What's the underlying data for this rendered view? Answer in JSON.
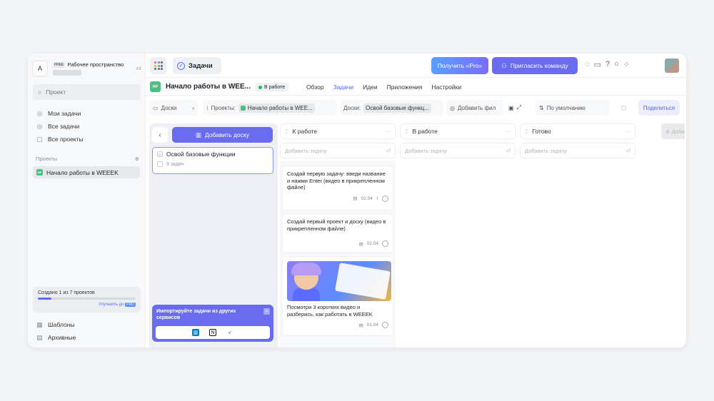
{
  "sidebar": {
    "workspace_avatar": "A",
    "workspace_plan": "FREE",
    "workspace_title": "Рабочее пространство",
    "collapse_icon": "‹‹",
    "search_placeholder": "Проект",
    "nav": [
      {
        "label": "Мои задачи",
        "icon": "check-circle-icon"
      },
      {
        "label": "Все задачи",
        "icon": "tasks-icon"
      },
      {
        "label": "Все проекты",
        "icon": "grid-icon"
      }
    ],
    "projects_section": "Проекты",
    "project_badge": "НР",
    "project_item": "Начало работы в WEEEK",
    "quota_text": "Создано 1 из 7 проектов",
    "quota_progress": 0.14,
    "upgrade_text": "Улучшить до",
    "upgrade_badge": "PRO",
    "bottom": [
      {
        "label": "Шаблоны",
        "icon": "templates-icon"
      },
      {
        "label": "Архивные",
        "icon": "archive-icon"
      }
    ]
  },
  "topbar": {
    "section_title": "Задачи",
    "pro_button": "Получить «Pro»",
    "invite_button": "Пригласить команду"
  },
  "project": {
    "badge": "НР",
    "title": "Начало работы в WEE...",
    "status": "В работе",
    "tabs": [
      "Обзор",
      "Задачи",
      "Идеи",
      "Приложения",
      "Настройки"
    ],
    "active_tab": "Задачи"
  },
  "filters": {
    "boards_label": "Доски",
    "projects_label": "Проекты:",
    "projects_value": "Начало работы в WEE...",
    "boards_filter_label": "Доски:",
    "boards_value": "Освой базовые функц...",
    "add_filter": "Добавить фил",
    "sort": "По умолчанию",
    "share": "Поделиться"
  },
  "boards_panel": {
    "add_board": "Добавить доску",
    "board_name": "Освой базовые функции",
    "board_count": "9 задач",
    "import_text": "Импортируйте задачи из других сервисов",
    "import_close": "×"
  },
  "columns": [
    {
      "title": "К работе",
      "add": "Добавить задачу"
    },
    {
      "title": "В работе",
      "add": "Добавить задачу"
    },
    {
      "title": "Готово",
      "add": "Добавить задачу"
    },
    {
      "title": "Добавить к"
    }
  ],
  "cards": [
    {
      "text": "Создай первую задачу: введи название и нажми Enter (видео в прикрепленном файле)",
      "date": "02.04"
    },
    {
      "text": "Создай первый проект и доску (видео в прикрепленном файле)",
      "date": "02.04"
    },
    {
      "text": "Посмотри 3 коротких видео и разберись, как работать в WEEEK",
      "date": "01.04"
    }
  ]
}
